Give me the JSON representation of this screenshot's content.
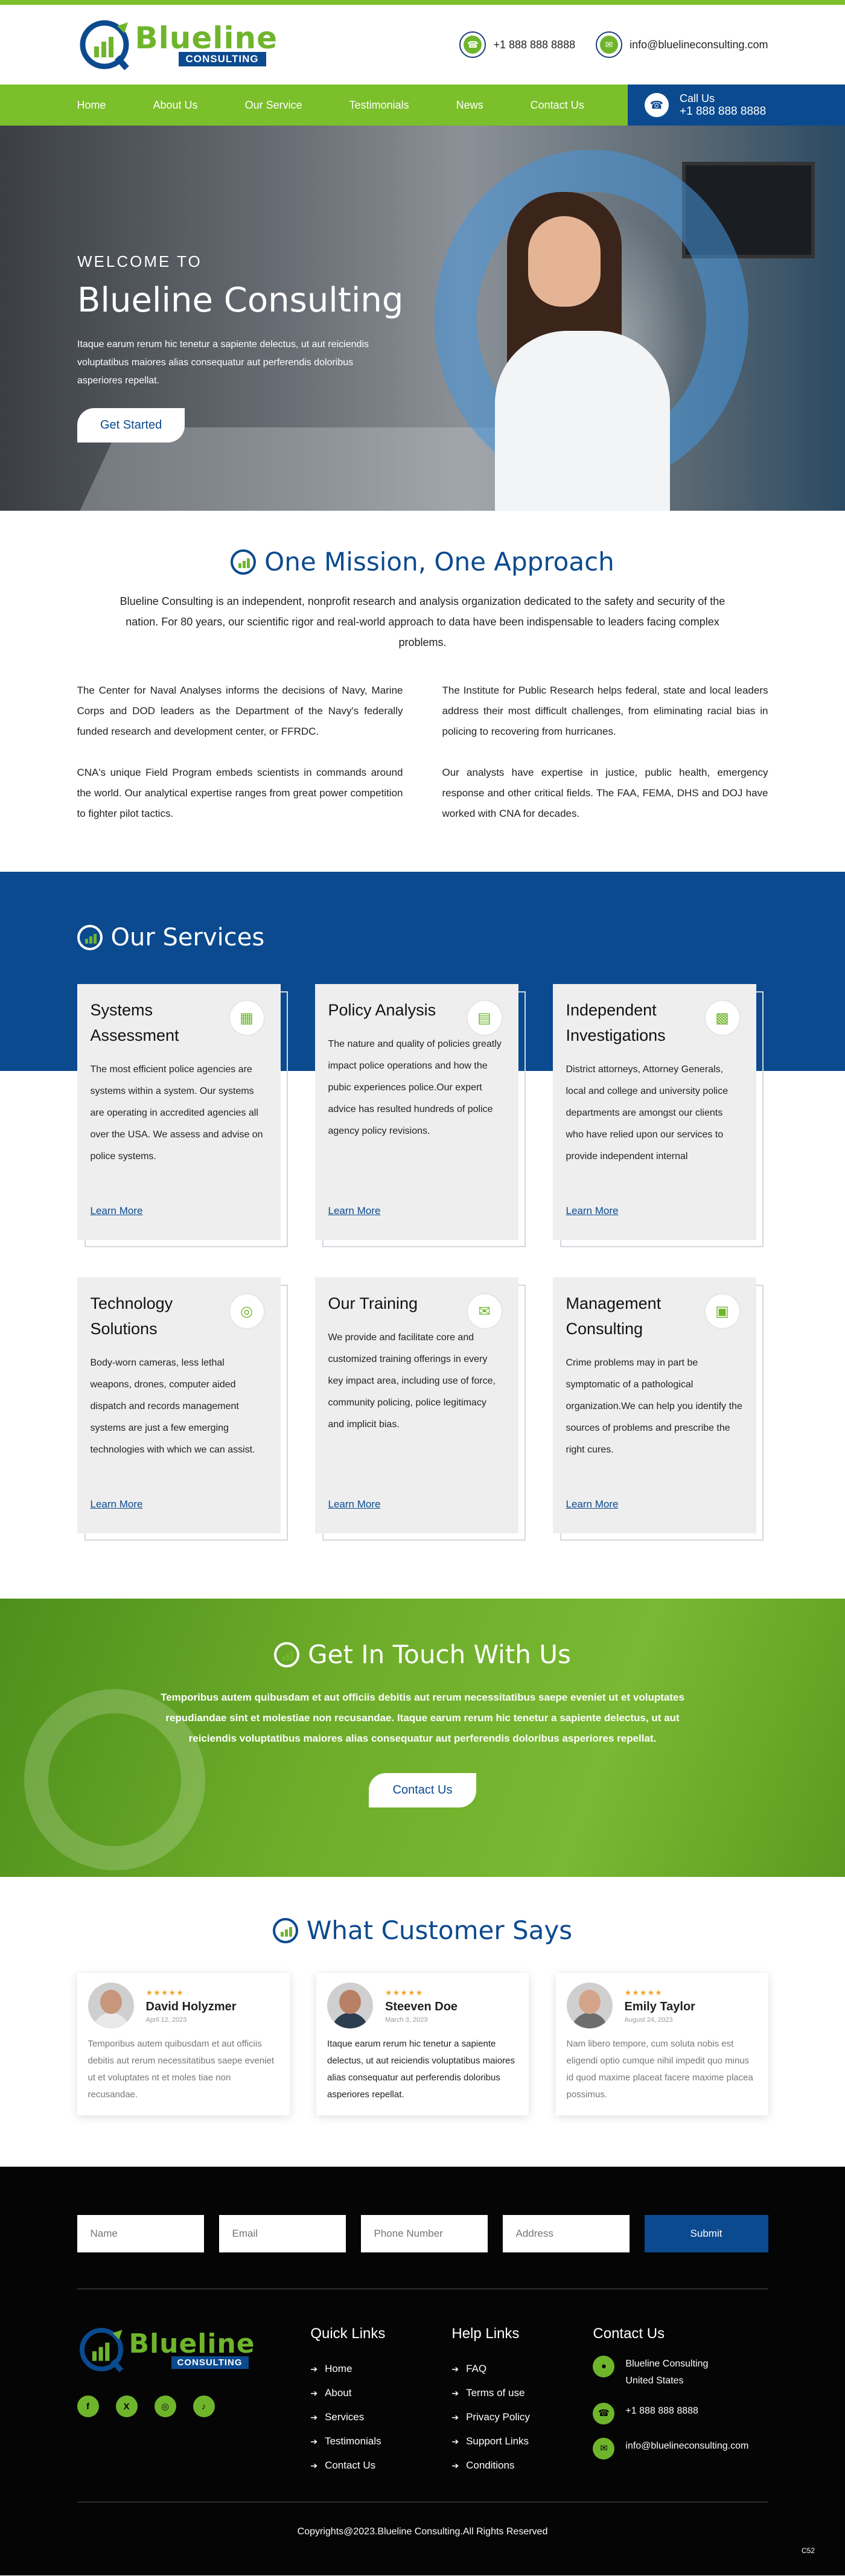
{
  "header": {
    "brand": "Blueline",
    "brand_sub": "CONSULTING",
    "phone": "+1 888 888 8888",
    "email": "info@bluelineconsulting.com"
  },
  "nav": {
    "items": [
      "Home",
      "About Us",
      "Our Service",
      "Testimonials",
      "News",
      "Contact Us"
    ],
    "call_label": "Call Us",
    "call_number": "+1 888 888 8888"
  },
  "hero": {
    "welcome": "WELCOME TO",
    "title": "Blueline Consulting",
    "text": "Itaque earum rerum hic tenetur a sapiente delectus, ut aut reiciendis voluptatibus maiores alias consequatur aut perferendis doloribus asperiores repellat.",
    "button": "Get Started"
  },
  "mission": {
    "title": "One Mission, One Approach",
    "lead": "Blueline Consulting is an independent, nonprofit research and analysis organization dedicated to the safety and security of the nation. For 80 years, our scientific rigor and real-world approach to data have been indispensable to leaders facing complex problems.",
    "left_p1": "The Center for Naval Analyses informs the decisions of Navy, Marine Corps and DOD leaders as the Department of the Navy's federally funded research and development center, or FFRDC.",
    "left_p2": "CNA's unique Field Program embeds scientists in commands around the world. Our analytical expertise ranges from great power competition to fighter pilot tactics.",
    "right_p1": "The Institute for Public Research helps federal, state and local leaders address their most difficult challenges, from eliminating racial bias in policing to recovering from hurricanes.",
    "right_p2": "Our analysts have expertise in justice, public health, emergency response and other critical fields. The FAA, FEMA, DHS and DOJ have worked with CNA for decades."
  },
  "services": {
    "title": "Our Services",
    "learn_more": "Learn More",
    "cards": [
      {
        "title": "Systems Assessment",
        "icon": "certificate-icon",
        "text": "The most efficient police agencies are systems within a system. Our systems are operating in accredited agencies all over the USA. We assess and advise on police systems."
      },
      {
        "title": "Policy Analysis",
        "icon": "document-icon",
        "text": "The nature and quality of policies greatly impact police operations and how the pubic experiences police.Our expert advice has resulted hundreds of police agency policy revisions."
      },
      {
        "title": "Independent Investigations",
        "icon": "report-icon",
        "text": "District attorneys, Attorney Generals, local and college and university police departments are amongst our clients who have relied upon our services to provide independent internal"
      },
      {
        "title": "Technology Solutions",
        "icon": "globe-icon",
        "text": "Body-worn cameras, less lethal weapons, drones, computer aided dispatch and records management systems are just a few emerging technologies with which we can assist."
      },
      {
        "title": "Our Training",
        "icon": "training-icon",
        "text": "We provide and facilitate core and customized training offerings in every key impact area, including use of force, community policing, police legitimacy and implicit bias."
      },
      {
        "title": "Management Consulting",
        "icon": "consulting-icon",
        "text": "Crime problems may in part be symptomatic of a pathological organization.We can help you identify the sources of problems and prescribe the right cures."
      }
    ]
  },
  "touch": {
    "title": "Get In Touch With Us",
    "text": "Temporibus autem quibusdam et aut officiis debitis aut rerum necessitatibus saepe eveniet ut et voluptates repudiandae sint et molestiae non recusandae. Itaque earum rerum hic tenetur a sapiente delectus, ut aut reiciendis voluptatibus maiores alias consequatur aut perferendis doloribus asperiores repellat.",
    "button": "Contact Us"
  },
  "testimonials": {
    "title": "What Customer Says",
    "items": [
      {
        "name": "David Holyzmer",
        "stars": "★★★★★",
        "date": "April 12, 2023",
        "text": "Temporibus autem quibusdam et aut officiis debitis aut rerum necessitatibus saepe eveniet ut et voluptates nt et moles tiae non recusandae."
      },
      {
        "name": "Steeven Doe",
        "stars": "★★★★★",
        "date": "March 3, 2023",
        "text": "Itaque earum rerum hic tenetur a sapiente delectus, ut aut reiciendis voluptatibus maiores alias consequatur aut perferendis doloribus asperiores repellat."
      },
      {
        "name": "Emily Taylor",
        "stars": "★★★★★",
        "date": "August 24, 2023",
        "text": "Nam libero tempore, cum soluta nobis est eligendi optio cumque nihil impedit quo minus id quod maxime placeat facere maxime placea possimus."
      }
    ]
  },
  "form": {
    "name": "Name",
    "email": "Email",
    "phone": "Phone Number",
    "address": "Address",
    "submit": "Submit"
  },
  "footer": {
    "brand": "Blueline",
    "brand_sub": "CONSULTING",
    "social": [
      "f",
      "X",
      "◎",
      "♪"
    ],
    "quick_title": "Quick Links",
    "quick_links": [
      "Home",
      "About",
      "Services",
      "Testimonials",
      "Contact Us"
    ],
    "help_title": "Help Links",
    "help_links": [
      "FAQ",
      "Terms of use",
      "Privacy Policy",
      "Support Links",
      "Conditions"
    ],
    "contact_title": "Contact Us",
    "address": "Blueline Consulting United States",
    "phone": "+1 888 888 8888",
    "email": "info@bluelineconsulting.com",
    "copyright": "Copyrights@2023.Blueline Consulting.All Rights Reserved",
    "corner": "C52"
  },
  "colors": {
    "green": "#7bbf2a",
    "blue": "#0b4a8f",
    "black": "#050505"
  }
}
